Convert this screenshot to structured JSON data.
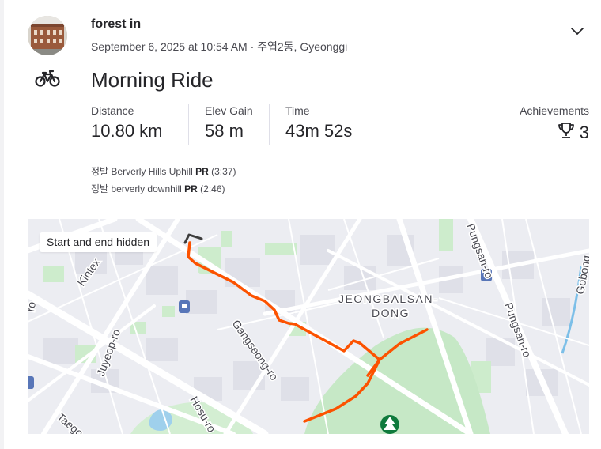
{
  "header": {
    "athlete_name": "forest in",
    "meta": "September 6, 2025 at 10:54 AM · 주엽2동, Gyeonggi"
  },
  "activity": {
    "title": "Morning Ride",
    "sport_icon": "bicycle-icon"
  },
  "stats": [
    {
      "label": "Distance",
      "value": "10.80 km"
    },
    {
      "label": "Elev Gain",
      "value": "58 m"
    },
    {
      "label": "Time",
      "value": "43m 52s"
    }
  ],
  "achievements": {
    "label": "Achievements",
    "count": "3",
    "icon": "trophy-icon"
  },
  "segments": [
    {
      "name": "정발 Berverly Hills Uphill",
      "badge": "PR",
      "time": "(3:37)"
    },
    {
      "name": "정발 berverly downhill",
      "badge": "PR",
      "time": "(2:46)"
    }
  ],
  "map": {
    "privacy_label": "Start and end hidden",
    "district_line1": "JEONGBALSAN-",
    "district_line2": "DONG",
    "roads": {
      "kintex": "Kintex",
      "juyeop": "Juyeop-ro",
      "gangseong": "Gangseong-ro",
      "hosu": "Hosu-ro",
      "pungsan1": "Pungsan-ro",
      "pungsan2": "Pungsan-ro",
      "gobong": "Gobong",
      "taego": "Taego",
      "ro": "ro"
    },
    "route_color": "#fc5200",
    "hidden_route_color": "#3d3d3d",
    "park_icon": "tree-icon",
    "transit_icon": "subway-station-icon"
  }
}
